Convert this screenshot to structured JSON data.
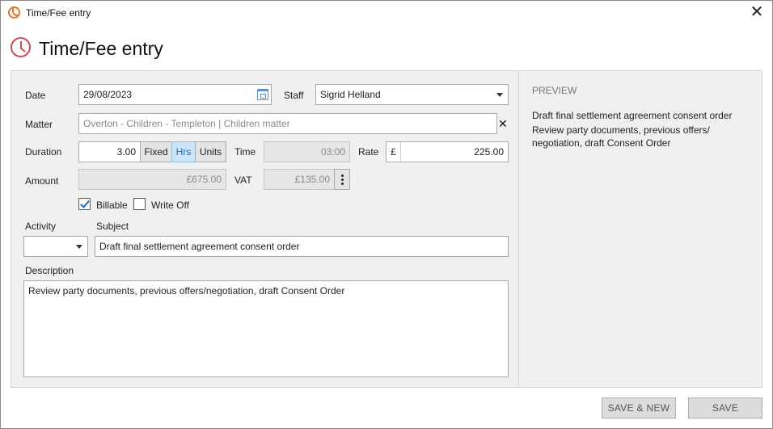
{
  "window": {
    "title": "Time/Fee entry",
    "close_glyph": "✕"
  },
  "header": {
    "title": "Time/Fee entry",
    "icon": "clock-icon"
  },
  "form": {
    "date_label": "Date",
    "date_value": "29/08/2023",
    "staff_label": "Staff",
    "staff_value": "Sigrid Helland",
    "matter_label": "Matter",
    "matter_value": "Overton - Children - Templeton | Children matter",
    "matter_clear": "✕",
    "duration_label": "Duration",
    "duration_value": "3.00",
    "duration_modes": [
      "Fixed",
      "Hrs",
      "Units"
    ],
    "duration_mode_selected": "Hrs",
    "time_label": "Time",
    "time_value": "03:00",
    "rate_label": "Rate",
    "rate_currency": "£",
    "rate_value": "225.00",
    "amount_label": "Amount",
    "amount_value": "£675.00",
    "vat_label": "VAT",
    "vat_value": "£135.00",
    "billable_label": "Billable",
    "billable_checked": true,
    "writeoff_label": "Write Off",
    "writeoff_checked": false,
    "activity_label": "Activity",
    "activity_value": "",
    "subject_label": "Subject",
    "subject_value": "Draft final settlement agreement consent order",
    "description_label": "Description",
    "description_value": "Review party documents, previous offers/negotiation, draft Consent Order"
  },
  "preview": {
    "title": "PREVIEW",
    "line1": "Draft final settlement agreement consent order",
    "line2": "Review party documents, previous offers/",
    "line3": "negotiation, draft Consent Order"
  },
  "buttons": {
    "save_new": "SAVE & NEW",
    "save": "SAVE"
  },
  "colors": {
    "accent": "#1a6fb8",
    "header_icon": "#c9505a",
    "app_icon": "#e0782f"
  }
}
